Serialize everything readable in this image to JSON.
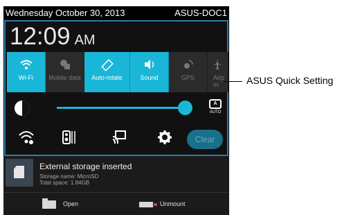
{
  "statusbar": {
    "date": "Wednesday October 30, 2013",
    "device": "ASUS-DOC1"
  },
  "clock": {
    "time": "12:09",
    "ampm": "AM"
  },
  "tiles": [
    {
      "label": "Wi-Fi",
      "icon": "wifi-icon",
      "on": true
    },
    {
      "label": "Mobile data",
      "icon": "mobile-data-icon",
      "on": false
    },
    {
      "label": "Auto-rotate",
      "icon": "auto-rotate-icon",
      "on": true
    },
    {
      "label": "Sound",
      "icon": "sound-icon",
      "on": true
    },
    {
      "label": "GPS",
      "icon": "gps-icon",
      "on": false
    },
    {
      "label": "Airp m",
      "icon": "airplane-mode-icon",
      "on": false
    }
  ],
  "brightness": {
    "level": 0.9,
    "auto_label": "AUTO"
  },
  "actions": {
    "clear_label": "Clear"
  },
  "notification": {
    "title": "External storage inserted",
    "storage_name": "Storage name: MicroSD",
    "total_space": "Total space: 1.84GB",
    "open_label": "Open",
    "unmount_label": "Unmount"
  },
  "callout": {
    "label": "ASUS Quick Setting"
  },
  "colors": {
    "accent": "#1ab6d7",
    "panel_border": "#2a7ea8"
  }
}
